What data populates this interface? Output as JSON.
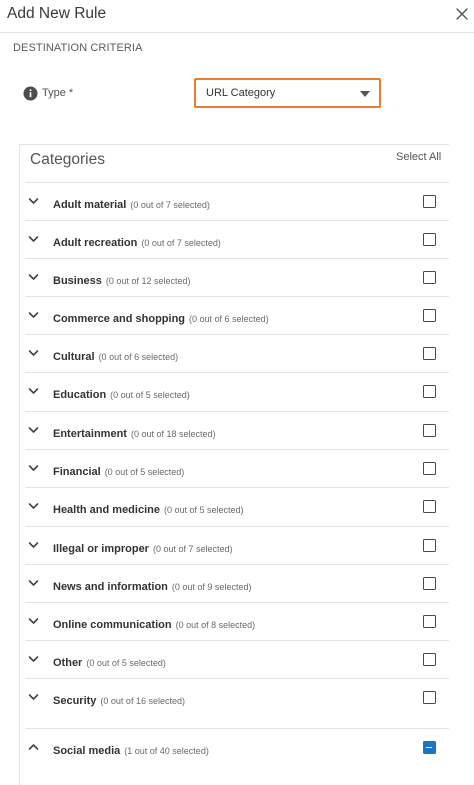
{
  "dialog": {
    "title": "Add New Rule",
    "section_label": "DESTINATION CRITERIA"
  },
  "type_field": {
    "label": "Type *",
    "value": "URL Category",
    "accent_color": "#ee7a2f"
  },
  "categories": {
    "title": "Categories",
    "select_all_label": "Select All",
    "items": [
      {
        "name": "Adult material",
        "count": "(0 out of 7 selected)",
        "state": "unchecked",
        "expanded": false
      },
      {
        "name": "Adult recreation",
        "count": "(0 out of 7 selected)",
        "state": "unchecked",
        "expanded": false
      },
      {
        "name": "Business",
        "count": "(0 out of 12 selected)",
        "state": "unchecked",
        "expanded": false
      },
      {
        "name": "Commerce and shopping",
        "count": "(0 out of 6 selected)",
        "state": "unchecked",
        "expanded": false
      },
      {
        "name": "Cultural",
        "count": "(0 out of 6 selected)",
        "state": "unchecked",
        "expanded": false
      },
      {
        "name": "Education",
        "count": "(0 out of 5 selected)",
        "state": "unchecked",
        "expanded": false
      },
      {
        "name": "Entertainment",
        "count": "(0 out of 18 selected)",
        "state": "unchecked",
        "expanded": false
      },
      {
        "name": "Financial",
        "count": "(0 out of 5 selected)",
        "state": "unchecked",
        "expanded": false
      },
      {
        "name": "Health and medicine",
        "count": "(0 out of 5 selected)",
        "state": "unchecked",
        "expanded": false
      },
      {
        "name": "Illegal or improper",
        "count": "(0 out of 7 selected)",
        "state": "unchecked",
        "expanded": false
      },
      {
        "name": "News and information",
        "count": "(0 out of 9 selected)",
        "state": "unchecked",
        "expanded": false
      },
      {
        "name": "Online communication",
        "count": "(0 out of 8 selected)",
        "state": "unchecked",
        "expanded": false
      },
      {
        "name": "Other",
        "count": "(0 out of 5 selected)",
        "state": "unchecked",
        "expanded": false
      },
      {
        "name": "Security",
        "count": "(0 out of 16 selected)",
        "state": "unchecked",
        "expanded": false
      },
      {
        "name": "Social media",
        "count": "(1 out of 40 selected)",
        "state": "indeterminate",
        "expanded": true
      }
    ],
    "checkbox_partial_color": "#1b74c5"
  }
}
